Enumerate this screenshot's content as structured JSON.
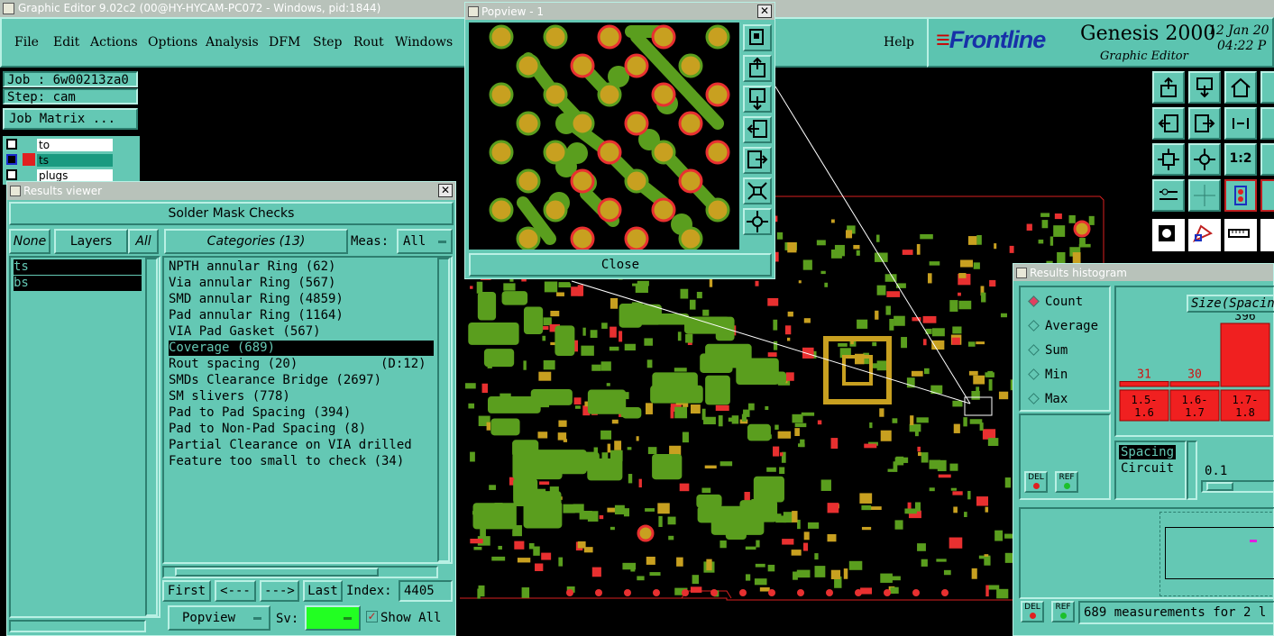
{
  "window": {
    "title": "Graphic Editor 9.02c2 (00@HY-HYCAM-PC072 - Windows, pid:1844)"
  },
  "menu": {
    "items": [
      "File",
      "Edit",
      "Actions",
      "Options",
      "Analysis",
      "DFM",
      "Step",
      "Rout",
      "Windows"
    ],
    "help": "Help"
  },
  "brand": {
    "logo": "Frontline",
    "product": "Genesis 2000",
    "subtitle": "Graphic Editor",
    "date": "12 Jan 20",
    "time": "04:22 P"
  },
  "job": {
    "job_label": "Job : 6w00213za0",
    "step_label": "Step: cam",
    "matrix_button": "Job Matrix ...",
    "layers": [
      "to",
      "ts",
      "plugs"
    ]
  },
  "results_viewer": {
    "title": "Results viewer",
    "header": "Solder Mask Checks",
    "none_button": "None",
    "layers_button": "Layers",
    "all_button": "All",
    "categories_button": "Categories (13)",
    "meas_label": "Meas:",
    "meas_value": "All",
    "layer_list": [
      "ts",
      "bs"
    ],
    "categories": [
      "NPTH annular Ring (62)",
      "Via annular Ring (567)",
      "SMD annular Ring (4859)",
      "Pad annular Ring (1164)",
      "VIA Pad Gasket (567)",
      "Coverage (689)",
      "Rout spacing (20)",
      "SMDs Clearance Bridge (2697)",
      "SM slivers (778)",
      "Pad to Pad Spacing (394)",
      "Pad to Non-Pad Spacing (8)",
      "Partial Clearance on VIA drilled",
      "Feature too small to check (34)"
    ],
    "rout_extra": "(D:12)",
    "selected_category": "Coverage (689)",
    "first_button": "First",
    "prev_button": "<---",
    "next_button": "--->",
    "last_button": "Last",
    "index_label": "Index:",
    "index_value": "4405",
    "popview_button": "Popview",
    "sv_label": "Sv:",
    "show_all_label": "Show All"
  },
  "popview": {
    "title": "Popview - 1",
    "close_button": "Close"
  },
  "histogram": {
    "title": "Results histogram",
    "options": [
      "Count",
      "Average",
      "Sum",
      "Min",
      "Max"
    ],
    "selected": "Count",
    "axis_title": "Size(Spacin",
    "bars": [
      {
        "range": "1.5-\n1.6",
        "count": 31
      },
      {
        "range": "1.6-\n1.7",
        "count": 30
      },
      {
        "range": "1.7-\n1.8",
        "count": 396
      }
    ],
    "spacing_list": [
      "Spacing",
      "Circuit"
    ],
    "slider_value": "0.1",
    "del_label": "DEL",
    "ref_label": "REF",
    "status": "689 measurements for 2 l"
  },
  "colors": {
    "teal": "#64c8b4",
    "copper": "#5a9e1e",
    "pad": "#c8a020",
    "ring": "#e83030"
  }
}
